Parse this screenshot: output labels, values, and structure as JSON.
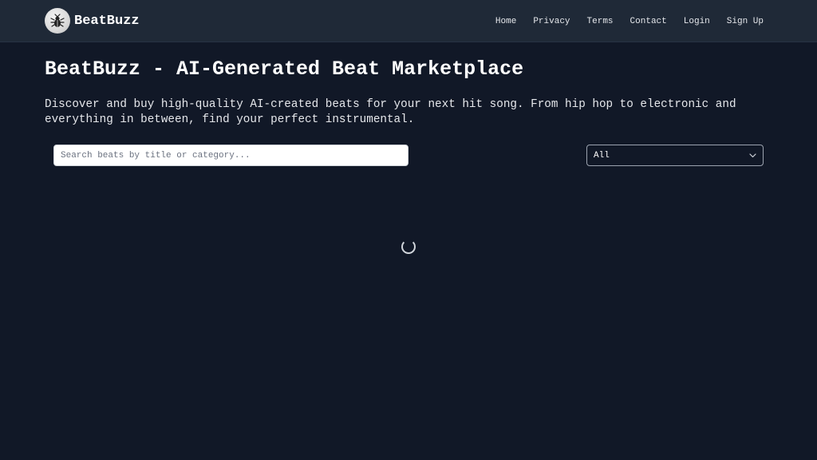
{
  "header": {
    "brand_name": "BeatBuzz",
    "logo_icon": "bug-logo-icon",
    "nav": [
      {
        "label": "Home"
      },
      {
        "label": "Privacy"
      },
      {
        "label": "Terms"
      },
      {
        "label": "Contact"
      },
      {
        "label": "Login"
      },
      {
        "label": "Sign Up"
      }
    ]
  },
  "main": {
    "title": "BeatBuzz - AI-Generated Beat Marketplace",
    "description": "Discover and buy high-quality AI-created beats for your next hit song. From hip hop to electronic and everything in between, find your perfect instrumental.",
    "search": {
      "placeholder": "Search beats by title or category...",
      "value": ""
    },
    "category_filter": {
      "selected": "All",
      "icon": "chevron-down-icon"
    },
    "loading_indicator": "spinner-icon"
  },
  "colors": {
    "background": "#111827",
    "header_background": "#1f2937",
    "text": "#ffffff"
  }
}
